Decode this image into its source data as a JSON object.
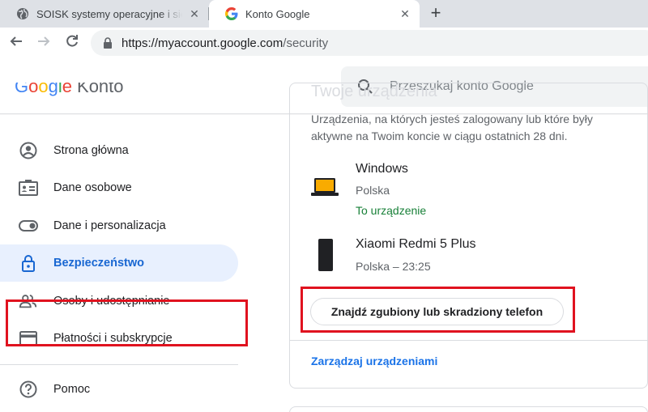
{
  "browser": {
    "tabs": [
      {
        "title": "SOISK systemy operacyjne i sieci",
        "icon": "globe-icon",
        "close": "✕"
      },
      {
        "title": "Konto Google",
        "icon": "google-g-icon",
        "close": "✕"
      }
    ],
    "new_tab": "+",
    "url_host": "https://myaccount.google.com",
    "url_path": "/security"
  },
  "header": {
    "logo_letters": [
      "G",
      "o",
      "o",
      "g",
      "l",
      "e"
    ],
    "logo_suffix": "Konto",
    "search_placeholder": "Przeszukaj konto Google"
  },
  "sidebar": {
    "items": [
      {
        "label": "Strona główna",
        "icon": "account-circle-icon"
      },
      {
        "label": "Dane osobowe",
        "icon": "id-card-icon"
      },
      {
        "label": "Dane i personalizacja",
        "icon": "toggle-icon"
      },
      {
        "label": "Bezpieczeństwo",
        "icon": "lock-icon",
        "active": true
      },
      {
        "label": "Osoby i udostępnianie",
        "icon": "people-icon"
      },
      {
        "label": "Płatności i subskrypcje",
        "icon": "credit-card-icon"
      },
      {
        "label": "Pomoc",
        "icon": "help-icon"
      }
    ]
  },
  "devices_card": {
    "title": "Twoje urządzenia",
    "description": "Urządzenia, na których jesteś zalogowany lub które były aktywne na Twoim koncie w ciągu ostatnich 28 dni.",
    "devices": [
      {
        "name": "Windows",
        "location": "Polska",
        "this_device": "To urządzenie",
        "icon": "laptop-icon"
      },
      {
        "name": "Xiaomi Redmi 5 Plus",
        "location": "Polska – 23:25",
        "icon": "phone-icon"
      }
    ],
    "find_phone_button": "Znajdź zgubiony lub skradziony telefon",
    "manage_link": "Zarządzaj urządzeniami"
  },
  "colors": {
    "active_bg": "#e8f0fe",
    "active_text": "#1967d2",
    "link": "#1a73e8",
    "success": "#188038",
    "highlight_border": "#e0121f"
  }
}
